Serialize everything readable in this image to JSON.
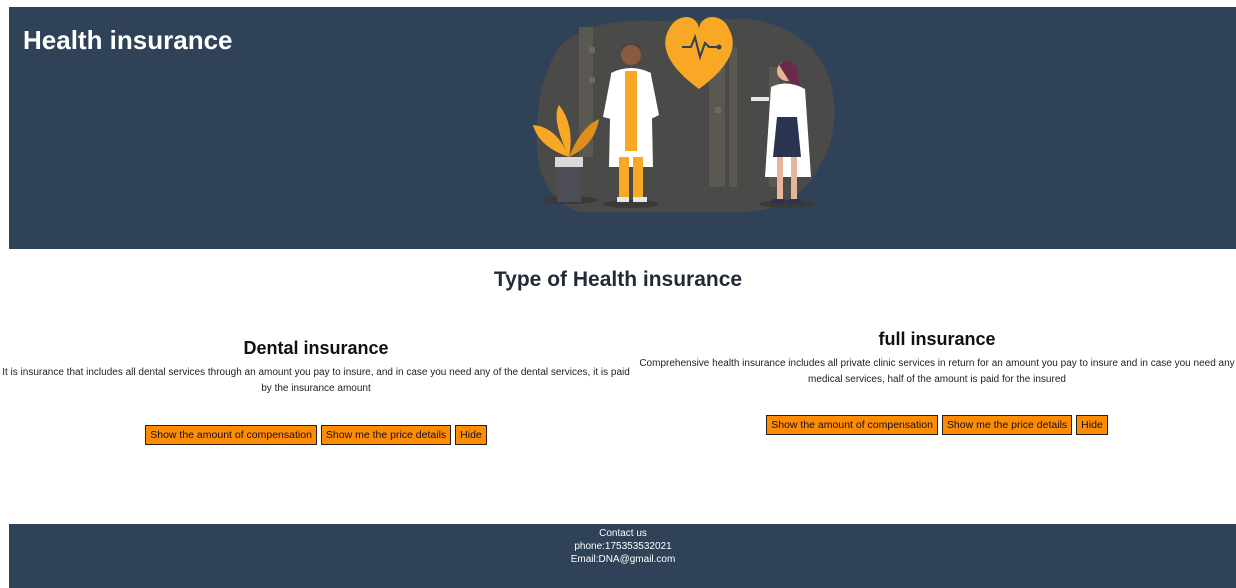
{
  "header": {
    "title": "Health insurance"
  },
  "section": {
    "title": "Type of Health insurance"
  },
  "cards": [
    {
      "title": "Dental insurance",
      "description": "It is insurance that includes all dental services through an amount you pay to insure, and in case you need any of the dental services, it is paid by the insurance amount",
      "buttons": [
        "Show the amount of compensation",
        "Show me the price details",
        "Hide"
      ]
    },
    {
      "title": "full insurance",
      "description": "Comprehensive health insurance includes all private clinic services in return for an amount you pay to insure and in case you need any medical services, half of the amount is paid for the insured",
      "buttons": [
        "Show the amount of compensation",
        "Show me the price details",
        "Hide"
      ]
    }
  ],
  "footer": {
    "heading": "Contact us",
    "phone": "phone:175353532021",
    "email": "Email:DNA@gmail.com"
  },
  "colors": {
    "header_bg": "#2f4257",
    "button_bg": "#ff8c00",
    "illustration_accent": "#f9a826"
  },
  "icons": {
    "illustration": "doctors-illustration",
    "heart": "heartbeat-heart-icon"
  }
}
